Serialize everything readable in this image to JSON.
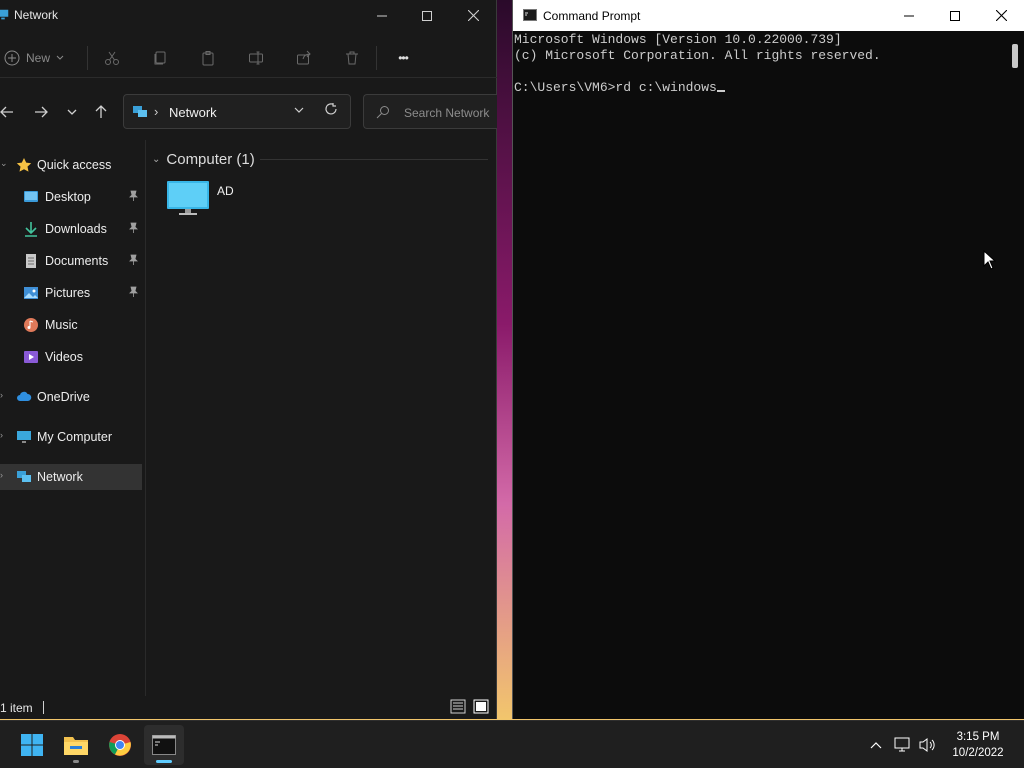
{
  "explorer": {
    "title": "Network",
    "toolbar": {
      "new_label": "New",
      "more_label": "•••"
    },
    "address": {
      "location": "Network",
      "search_placeholder": "Search Network"
    },
    "nav": {
      "quick_access": "Quick access",
      "pinned": [
        {
          "label": "Desktop"
        },
        {
          "label": "Downloads"
        },
        {
          "label": "Documents"
        },
        {
          "label": "Pictures"
        }
      ],
      "music": "Music",
      "videos": "Videos",
      "onedrive": "OneDrive",
      "my_computer": "My Computer",
      "network": "Network"
    },
    "content": {
      "group_title": "Computer (1)",
      "items": [
        {
          "label": "AD"
        }
      ]
    },
    "status": {
      "item_count": "1 item"
    }
  },
  "cmd": {
    "title": "Command Prompt",
    "lines": [
      "Microsoft Windows [Version 10.0.22000.739]",
      "(c) Microsoft Corporation. All rights reserved.",
      "",
      "C:\\Users\\VM6>rd c:\\windows"
    ]
  },
  "taskbar": {
    "time": "3:15 PM",
    "date": "10/2/2022"
  },
  "colors": {
    "accent": "#60cdff",
    "explorer_bg": "#191919",
    "cmd_bg": "#0c0c0c",
    "taskbar_bg": "#1f1f1f"
  }
}
